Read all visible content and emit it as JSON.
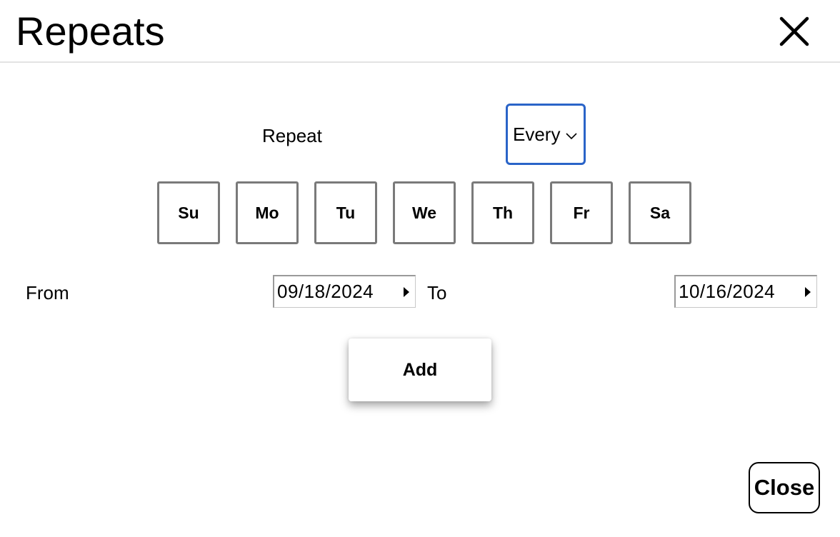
{
  "header": {
    "title": "Repeats",
    "close_icon": "close-x-icon"
  },
  "repeat": {
    "label": "Repeat",
    "selected": "Every",
    "dropdown_icon": "chevron-down-icon",
    "accent_color": "#2a64c8"
  },
  "days": [
    {
      "label": "Su"
    },
    {
      "label": "Mo"
    },
    {
      "label": "Tu"
    },
    {
      "label": "We"
    },
    {
      "label": "Th"
    },
    {
      "label": "Fr"
    },
    {
      "label": "Sa"
    }
  ],
  "range": {
    "from_label": "From",
    "from_value": "09/18/2024",
    "to_label": "To",
    "to_value": "10/16/2024",
    "picker_icon": "triangle-right-icon"
  },
  "actions": {
    "add_label": "Add",
    "close_label": "Close"
  }
}
